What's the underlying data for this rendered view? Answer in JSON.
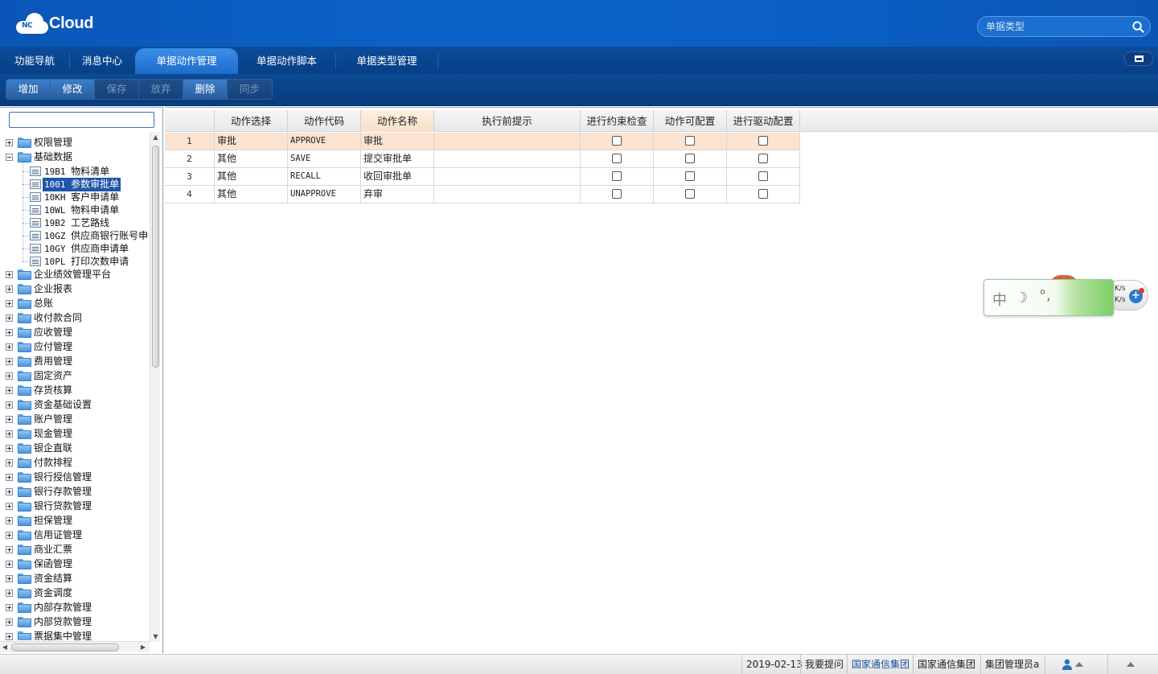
{
  "app": {
    "logo_badge": "NC",
    "logo_text": "Cloud"
  },
  "search": {
    "placeholder": "单据类型"
  },
  "tabs": [
    {
      "label": "功能导航"
    },
    {
      "label": "消息中心"
    },
    {
      "label": "单据动作管理",
      "active": true
    },
    {
      "label": "单据动作脚本"
    },
    {
      "label": "单据类型管理"
    }
  ],
  "toolbar": [
    {
      "label": "增加",
      "enabled": true
    },
    {
      "label": "修改",
      "enabled": true
    },
    {
      "label": "保存",
      "enabled": false
    },
    {
      "label": "放弃",
      "enabled": false
    },
    {
      "label": "删除",
      "enabled": true
    },
    {
      "label": "同步",
      "enabled": false
    }
  ],
  "tree": {
    "search_value": "",
    "nodes": [
      {
        "label": "权限管理",
        "expanded": false
      },
      {
        "label": "基础数据",
        "expanded": true,
        "children": [
          {
            "code": "19B1",
            "label": "物料清单"
          },
          {
            "code": "1001",
            "label": "参数审批单",
            "selected": true
          },
          {
            "code": "10KH",
            "label": "客户申请单"
          },
          {
            "code": "10WL",
            "label": "物料申请单"
          },
          {
            "code": "19B2",
            "label": "工艺路线"
          },
          {
            "code": "10GZ",
            "label": "供应商银行账号申"
          },
          {
            "code": "10GY",
            "label": "供应商申请单"
          },
          {
            "code": "10PL",
            "label": "打印次数申请"
          }
        ]
      },
      {
        "label": "企业绩效管理平台"
      },
      {
        "label": "企业报表"
      },
      {
        "label": "总账"
      },
      {
        "label": "收付款合同"
      },
      {
        "label": "应收管理"
      },
      {
        "label": "应付管理"
      },
      {
        "label": "费用管理"
      },
      {
        "label": "固定资产"
      },
      {
        "label": "存货核算"
      },
      {
        "label": "资金基础设置"
      },
      {
        "label": "账户管理"
      },
      {
        "label": "现金管理"
      },
      {
        "label": "银企直联"
      },
      {
        "label": "付款排程"
      },
      {
        "label": "银行授信管理"
      },
      {
        "label": "银行存款管理"
      },
      {
        "label": "银行贷款管理"
      },
      {
        "label": "担保管理"
      },
      {
        "label": "信用证管理"
      },
      {
        "label": "商业汇票"
      },
      {
        "label": "保函管理"
      },
      {
        "label": "资金结算"
      },
      {
        "label": "资金调度"
      },
      {
        "label": "内部存款管理"
      },
      {
        "label": "内部贷款管理"
      },
      {
        "label": "票据集中管理"
      }
    ]
  },
  "grid": {
    "columns": [
      "",
      "动作选择",
      "动作代码",
      "动作名称",
      "执行前提示",
      "进行约束检查",
      "动作可配置",
      "进行驱动配置"
    ],
    "rows": [
      {
        "no": "1",
        "choice": "审批",
        "code": "APPROVE",
        "name": "审批",
        "hint": "",
        "c1": false,
        "c2": false,
        "c3": false,
        "selected": true
      },
      {
        "no": "2",
        "choice": "其他",
        "code": "SAVE",
        "name": "提交审批单",
        "hint": "",
        "c1": false,
        "c2": false,
        "c3": false
      },
      {
        "no": "3",
        "choice": "其他",
        "code": "RECALL",
        "name": "收回审批单",
        "hint": "",
        "c1": false,
        "c2": false,
        "c3": false
      },
      {
        "no": "4",
        "choice": "其他",
        "code": "UNAPPROVE",
        "name": "弃审",
        "hint": "",
        "c1": false,
        "c2": false,
        "c3": false
      }
    ]
  },
  "ime": {
    "char": "中",
    "moon": "☽",
    "punct": "°,",
    "speed1": "K/s",
    "speed2": "K/s",
    "plus": "+"
  },
  "status": {
    "date": "2019-02-13",
    "ask": "我要提问",
    "group_link": "国家通信集团",
    "group": "国家通信集团",
    "role": "集团管理员a"
  }
}
